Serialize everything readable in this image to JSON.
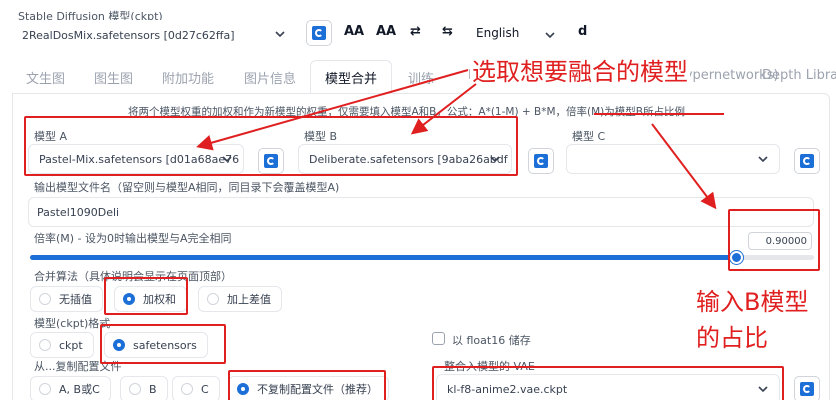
{
  "checkpoint": {
    "label": "Stable Diffusion 模型(ckpt)",
    "value": "2RealDosMix.safetensors [0d27c62ffa]"
  },
  "toolbar": {
    "btn_aa1": "AA",
    "btn_aa2": "AA",
    "btn_swap": "⇄",
    "btn_swap2": "⇆",
    "language": "English",
    "user": "d"
  },
  "tabs": [
    "文生图",
    "图生图",
    "附加功能",
    "图片信息",
    "模型合并",
    "训练",
    "P",
    "(Hypernetworks)",
    "Depth Library"
  ],
  "annotations": {
    "top": "选取想要融合的模型",
    "right_line1": "输入B模型",
    "right_line2": "的占比"
  },
  "description": "将两个模型权重的加权和作为新模型的权重，仅需要填入模型A和B，公式：A*(1-M) + B*M，倍率(M)为模型B所占比例",
  "model_a": {
    "label": "模型 A",
    "value": "Pastel-Mix.safetensors [d01a68ae76"
  },
  "model_b": {
    "label": "模型 B",
    "value": "Deliberate.safetensors [9aba26abdf"
  },
  "model_c": {
    "label": "模型 C",
    "value": ""
  },
  "output_name": {
    "label": "输出模型文件名（留空则与模型A相同，同目录下会覆盖模型A)",
    "value": "Pastel1090Deli"
  },
  "multiplier": {
    "label": "倍率(M) - 设为0时输出模型与A完全相同",
    "value": "0.90000",
    "fraction": 0.9
  },
  "interp": {
    "label": "合并算法（具体说明会显示在页面顶部）",
    "options": [
      "无插值",
      "加权和",
      "加上差值"
    ],
    "selected": 1
  },
  "format": {
    "label": "模型(ckpt)格式",
    "options": [
      "ckpt",
      "safetensors"
    ],
    "selected": 1
  },
  "float16": {
    "label": "以 float16 储存"
  },
  "config": {
    "label": "从...复制配置文件",
    "options": [
      "A, B或C",
      "B",
      "C",
      "不复制配置文件（推荐）"
    ],
    "selected": 3
  },
  "vae": {
    "label": "整合入模型的 VAE",
    "value": "kl-f8-anime2.vae.ckpt"
  },
  "colors": {
    "accent": "#1d6fd8",
    "annotation": "#e02020"
  }
}
